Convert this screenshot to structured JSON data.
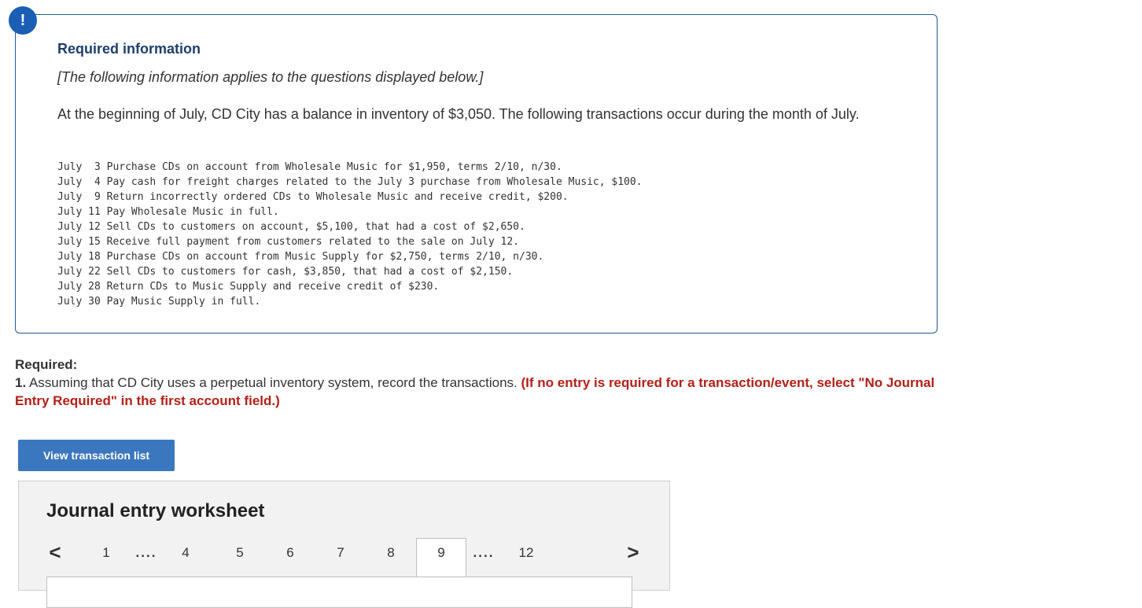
{
  "alert": {
    "icon": "exclamation-icon",
    "glyph": "!"
  },
  "info": {
    "title": "Required information",
    "note": "[The following information applies to the questions displayed below.]",
    "body": "At the beginning of July, CD City has a balance in inventory of $3,050. The following transactions occur during the month of July.",
    "transactions": [
      "July  3 Purchase CDs on account from Wholesale Music for $1,950, terms 2/10, n/30.",
      "July  4 Pay cash for freight charges related to the July 3 purchase from Wholesale Music, $100.",
      "July  9 Return incorrectly ordered CDs to Wholesale Music and receive credit, $200.",
      "July 11 Pay Wholesale Music in full.",
      "July 12 Sell CDs to customers on account, $5,100, that had a cost of $2,650.",
      "July 15 Receive full payment from customers related to the sale on July 12.",
      "July 18 Purchase CDs on account from Music Supply for $2,750, terms 2/10, n/30.",
      "July 22 Sell CDs to customers for cash, $3,850, that had a cost of $2,150.",
      "July 28 Return CDs to Music Supply and receive credit of $230.",
      "July 30 Pay Music Supply in full."
    ]
  },
  "required": {
    "label": "Required:",
    "number": "1.",
    "text": " Assuming that CD City uses a perpetual inventory system, record the transactions. ",
    "note": "(If no entry is required for a transaction/event, select \"No Journal Entry Required\" in the first account field.)"
  },
  "view_button": {
    "label": "View transaction list"
  },
  "worksheet": {
    "title": "Journal entry worksheet",
    "pager": {
      "prev": "<",
      "next": ">",
      "dots": "....",
      "pages": [
        "1",
        "4",
        "5",
        "6",
        "7",
        "8",
        "9",
        "12"
      ],
      "active": "9"
    }
  },
  "colors": {
    "accent": "#3b77be",
    "box_border": "#1f5a93",
    "title_blue": "#1d3f6e",
    "alert_red": "#b32017"
  }
}
